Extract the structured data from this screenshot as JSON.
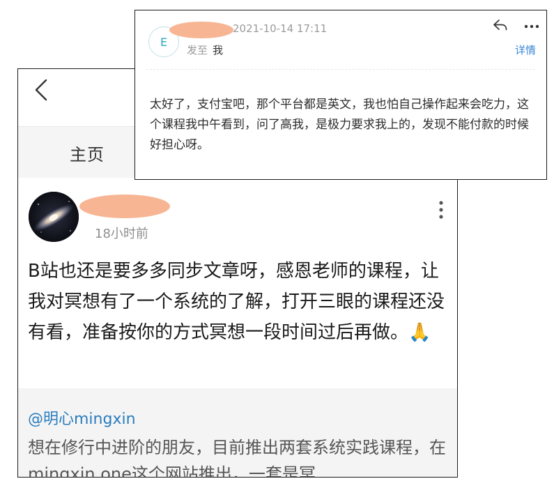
{
  "post": {
    "tab_home": "主页",
    "time": "18小时前",
    "body": "B站也还是要多多同步文章呀，感恩老师的课程，让我对冥想有了一个系统的了解，打开三眼的课程还没有看，准备按你的方式冥想一段时间过后再做。🙏",
    "reply": {
      "author": "@明心mingxin",
      "text": "想在修行中进阶的朋友，目前推出两套系统实践课程，在mingxin.one这个网站推出，一套是冥"
    },
    "icons": {
      "back": "chevron-left-icon",
      "more": "vertical-dots-icon",
      "avatar": "galaxy-avatar"
    }
  },
  "email": {
    "avatar_letter": "E",
    "date": "2021-10-14 17:11",
    "to_prefix": "发至",
    "to_name": "我",
    "details": "详情",
    "body": "太好了，支付宝吧，那个平台都是英文，我也怕自己操作起来会吃力，这个课程我中午看到，问了高我，是极力要求我上的，发现不能付款的时候好担心呀。",
    "icons": {
      "reply": "reply-icon",
      "more": "horizontal-dots-icon"
    }
  },
  "colors": {
    "redaction_mask": "#f7b594",
    "link_blue": "#2a7dbe",
    "avatar_teal": "#2aa7b9"
  }
}
